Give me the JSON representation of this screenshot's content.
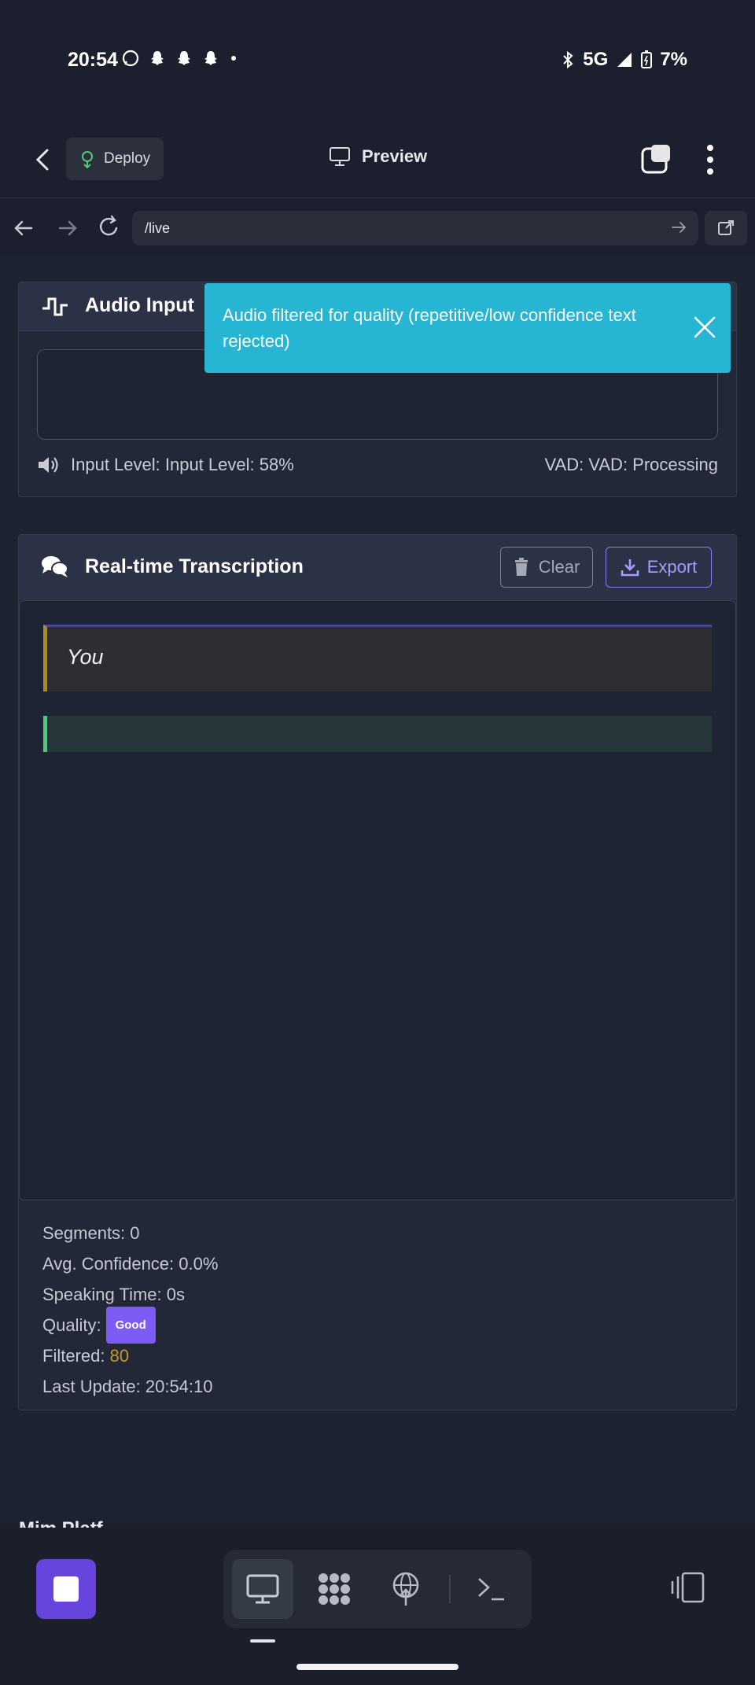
{
  "status_bar": {
    "time": "20:54",
    "network": "5G",
    "battery": "7%",
    "icons": [
      "whatsapp-icon",
      "snapchat-icon",
      "snapchat-icon",
      "snapchat-icon",
      "dot-icon",
      "bluetooth-icon",
      "signal-icon",
      "battery-icon"
    ]
  },
  "header": {
    "deploy_label": "Deploy",
    "preview_label": "Preview"
  },
  "url_bar": {
    "url": "/live"
  },
  "audio_input": {
    "title": "Audio Input",
    "level_text": "Input Level: Input Level: 58%",
    "vad_text": "VAD: VAD: Processing"
  },
  "toast": {
    "message": "Audio filtered for quality (repetitive/low confidence text rejected)"
  },
  "transcription": {
    "title": "Real-time Transcription",
    "clear_label": "Clear",
    "export_label": "Export",
    "items": [
      {
        "speaker": "You",
        "text": ""
      },
      {
        "speaker": "",
        "text": ""
      }
    ]
  },
  "stats": {
    "segments": "Segments: 0",
    "avg_confidence": "Avg. Confidence: 0.0%",
    "speaking_time": "Speaking Time: 0s",
    "quality_label": "Quality:",
    "quality_badge": "Good",
    "filtered_label": "Filtered:",
    "filtered_value": "80",
    "last_update": "Last Update: 20:54:10"
  },
  "partial_section": {
    "text": "Mim Platf"
  },
  "colors": {
    "accent": "#6644dd",
    "toast": "#26b6d4",
    "badge": "#7c5cf5",
    "filtered": "#c49a1e",
    "you_border": "#b08a1a",
    "green_border": "#4ecb7a"
  }
}
